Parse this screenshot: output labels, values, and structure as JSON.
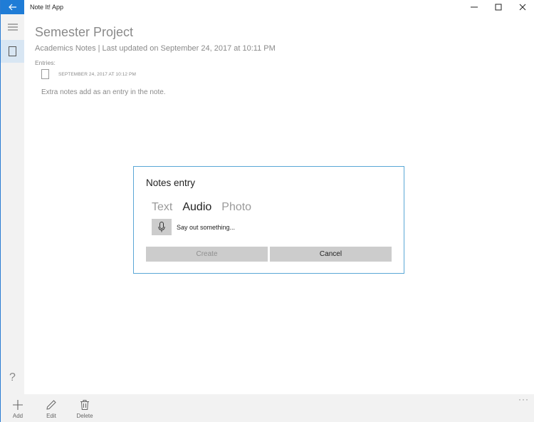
{
  "window": {
    "app_title": "Note It! App",
    "accent": "#1f7cd6"
  },
  "nav": {
    "help_label": "?"
  },
  "page": {
    "title": "Semester Project",
    "subtitle": "Academics Notes | Last updated on September 24, 2017 at 10:11 PM",
    "entries_label": "Entries:",
    "entry": {
      "date": "SEPTEMBER 24, 2017 AT 10:12 PM",
      "text": "Extra notes add as an entry in the note."
    }
  },
  "dialog": {
    "title": "Notes entry",
    "tabs": [
      "Text",
      "Audio",
      "Photo"
    ],
    "active_tab": "Audio",
    "mic_prompt": "Say out something...",
    "create_label": "Create",
    "cancel_label": "Cancel"
  },
  "appbar": {
    "add_label": "Add",
    "edit_label": "Edit",
    "delete_label": "Delete",
    "more_label": "···"
  }
}
